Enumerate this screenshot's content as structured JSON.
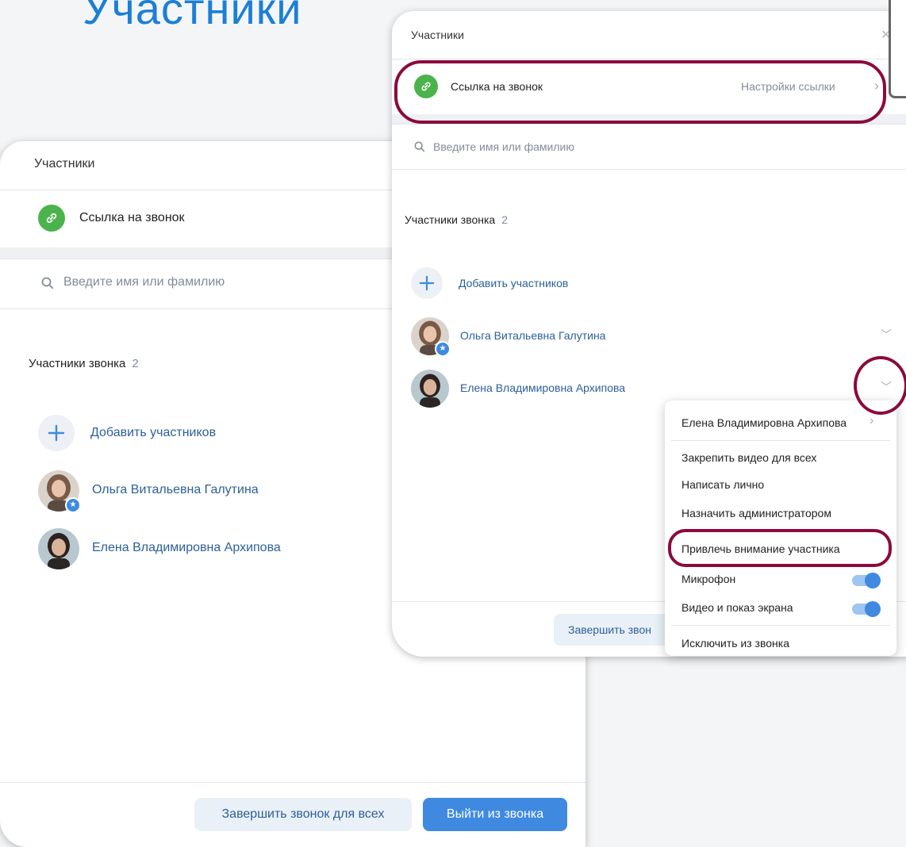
{
  "slide": {
    "title": "Участники"
  },
  "back_panel": {
    "header_title": "Участники",
    "call_link_label": "Ссылка на звонок",
    "search_placeholder": "Введите имя или фамилию",
    "section_title": "Участники звонка",
    "participant_count": "2",
    "add_participants_label": "Добавить участников",
    "participants": [
      {
        "name": "Ольга Витальевна Галутина",
        "is_admin": true
      },
      {
        "name": "Елена Владимировна Архипова",
        "is_admin": false
      }
    ],
    "end_call_all_label": "Завершить звонок для всех",
    "leave_call_label": "Выйти из звонка"
  },
  "front_panel": {
    "header_title": "Участники",
    "close_icon": "✕",
    "call_link_label": "Ссылка на звонок",
    "link_settings_label": "Настройки ссылки",
    "search_placeholder": "Введите имя или фамилию",
    "section_title": "Участники звонка",
    "participant_count": "2",
    "add_participants_label": "Добавить участников",
    "participants": [
      {
        "name": "Ольга Витальевна Галутина",
        "is_admin": true
      },
      {
        "name": "Елена Владимировна Архипова",
        "is_admin": false
      }
    ],
    "end_call_label_partial": "Завершить звон"
  },
  "context_menu": {
    "header_name": "Елена Владимировна Архипова",
    "items": [
      "Закрепить видео для всех",
      "Написать лично",
      "Назначить администратором",
      "Привлечь внимание участника"
    ],
    "toggles": [
      {
        "label": "Микрофон",
        "on": true
      },
      {
        "label": "Видео и показ экрана",
        "on": true
      }
    ],
    "exclude_label": "Исключить из звонка"
  },
  "colors": {
    "accent": "#3f8ae0",
    "link_green": "#4bb34b",
    "highlight": "#8b0a3d",
    "title_blue": "#1b7fd6",
    "name_blue": "#2d5f99"
  }
}
